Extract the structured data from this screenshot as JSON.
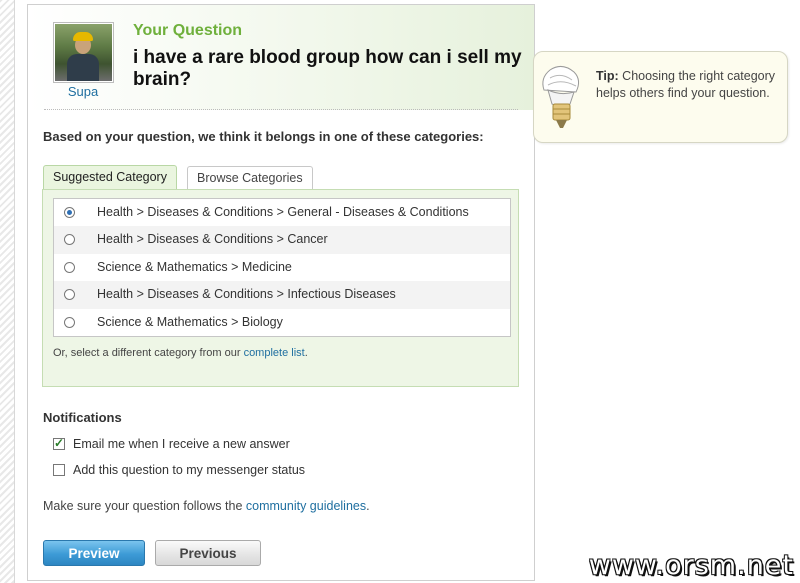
{
  "user": {
    "name": "Supa"
  },
  "question": {
    "label": "Your Question",
    "title": "i have a rare blood group how can i sell my brain?"
  },
  "tip": {
    "heading": "Tip:",
    "text": "Choosing the right category helps others find your question."
  },
  "categories": {
    "prompt": "Based on your question, we think it belongs in one of these categories:",
    "tabs": [
      {
        "label": "Suggested Category",
        "active": true
      },
      {
        "label": "Browse Categories",
        "active": false
      }
    ],
    "options": [
      {
        "label": "Health > Diseases & Conditions > General - Diseases & Conditions",
        "selected": true
      },
      {
        "label": "Health > Diseases & Conditions > Cancer",
        "selected": false
      },
      {
        "label": "Science & Mathematics > Medicine",
        "selected": false
      },
      {
        "label": "Health > Diseases & Conditions > Infectious Diseases",
        "selected": false
      },
      {
        "label": "Science & Mathematics > Biology",
        "selected": false
      }
    ],
    "alt_prefix": "Or, select a different category from our",
    "alt_link": "complete list",
    "alt_suffix": "."
  },
  "notifications": {
    "title": "Notifications",
    "email": {
      "label": "Email me when I receive a new answer",
      "checked": true
    },
    "messenger": {
      "label": "Add this question to my messenger status",
      "checked": false
    }
  },
  "guidelines": {
    "prefix": "Make sure your question follows the",
    "link": "community guidelines",
    "suffix": "."
  },
  "buttons": {
    "preview": "Preview",
    "previous": "Previous"
  },
  "watermark": "www.orsm.net"
}
